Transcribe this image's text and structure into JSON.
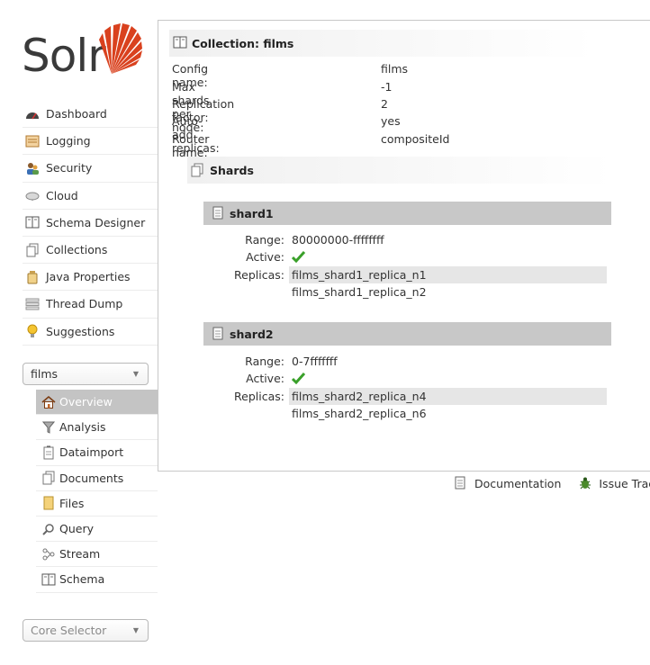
{
  "brand": {
    "logo_text": "Solr",
    "accent_color": "#d9411e"
  },
  "nav": [
    {
      "label": "Dashboard",
      "icon": "dashboard-icon"
    },
    {
      "label": "Logging",
      "icon": "logging-icon"
    },
    {
      "label": "Security",
      "icon": "security-icon"
    },
    {
      "label": "Cloud",
      "icon": "cloud-icon"
    },
    {
      "label": "Schema Designer",
      "icon": "schema-designer-icon"
    },
    {
      "label": "Collections",
      "icon": "collections-icon"
    },
    {
      "label": "Java Properties",
      "icon": "java-properties-icon"
    },
    {
      "label": "Thread Dump",
      "icon": "thread-dump-icon"
    },
    {
      "label": "Suggestions",
      "icon": "suggestions-icon"
    }
  ],
  "collection_selector": {
    "value": "films"
  },
  "subnav": [
    {
      "label": "Overview",
      "icon": "home-icon",
      "active": true
    },
    {
      "label": "Analysis",
      "icon": "filter-icon"
    },
    {
      "label": "Dataimport",
      "icon": "dataimport-icon"
    },
    {
      "label": "Documents",
      "icon": "documents-icon"
    },
    {
      "label": "Files",
      "icon": "folder-icon"
    },
    {
      "label": "Query",
      "icon": "search-icon"
    },
    {
      "label": "Stream",
      "icon": "stream-icon"
    },
    {
      "label": "Schema",
      "icon": "schema-icon"
    }
  ],
  "core_selector": {
    "placeholder": "Core Selector"
  },
  "collection": {
    "title": "Collection: films",
    "properties": [
      {
        "key": "Config name:",
        "value": "films"
      },
      {
        "key": "Max shards per node:",
        "value": "-1"
      },
      {
        "key": "Replication factor:",
        "value": "2"
      },
      {
        "key": "Auto-add replicas:",
        "value": "yes"
      },
      {
        "key": "Router name:",
        "value": "compositeId"
      }
    ]
  },
  "shards": {
    "title": "Shards",
    "labels": {
      "range": "Range:",
      "active": "Active:",
      "replicas": "Replicas:"
    },
    "items": [
      {
        "name": "shard1",
        "range": "80000000-ffffffff",
        "active": true,
        "replicas": [
          "films_shard1_replica_n1",
          "films_shard1_replica_n2"
        ]
      },
      {
        "name": "shard2",
        "range": "0-7fffffff",
        "active": true,
        "replicas": [
          "films_shard2_replica_n4",
          "films_shard2_replica_n6"
        ]
      }
    ]
  },
  "footer": {
    "documentation": "Documentation",
    "issue_tracker": "Issue Tracker"
  }
}
